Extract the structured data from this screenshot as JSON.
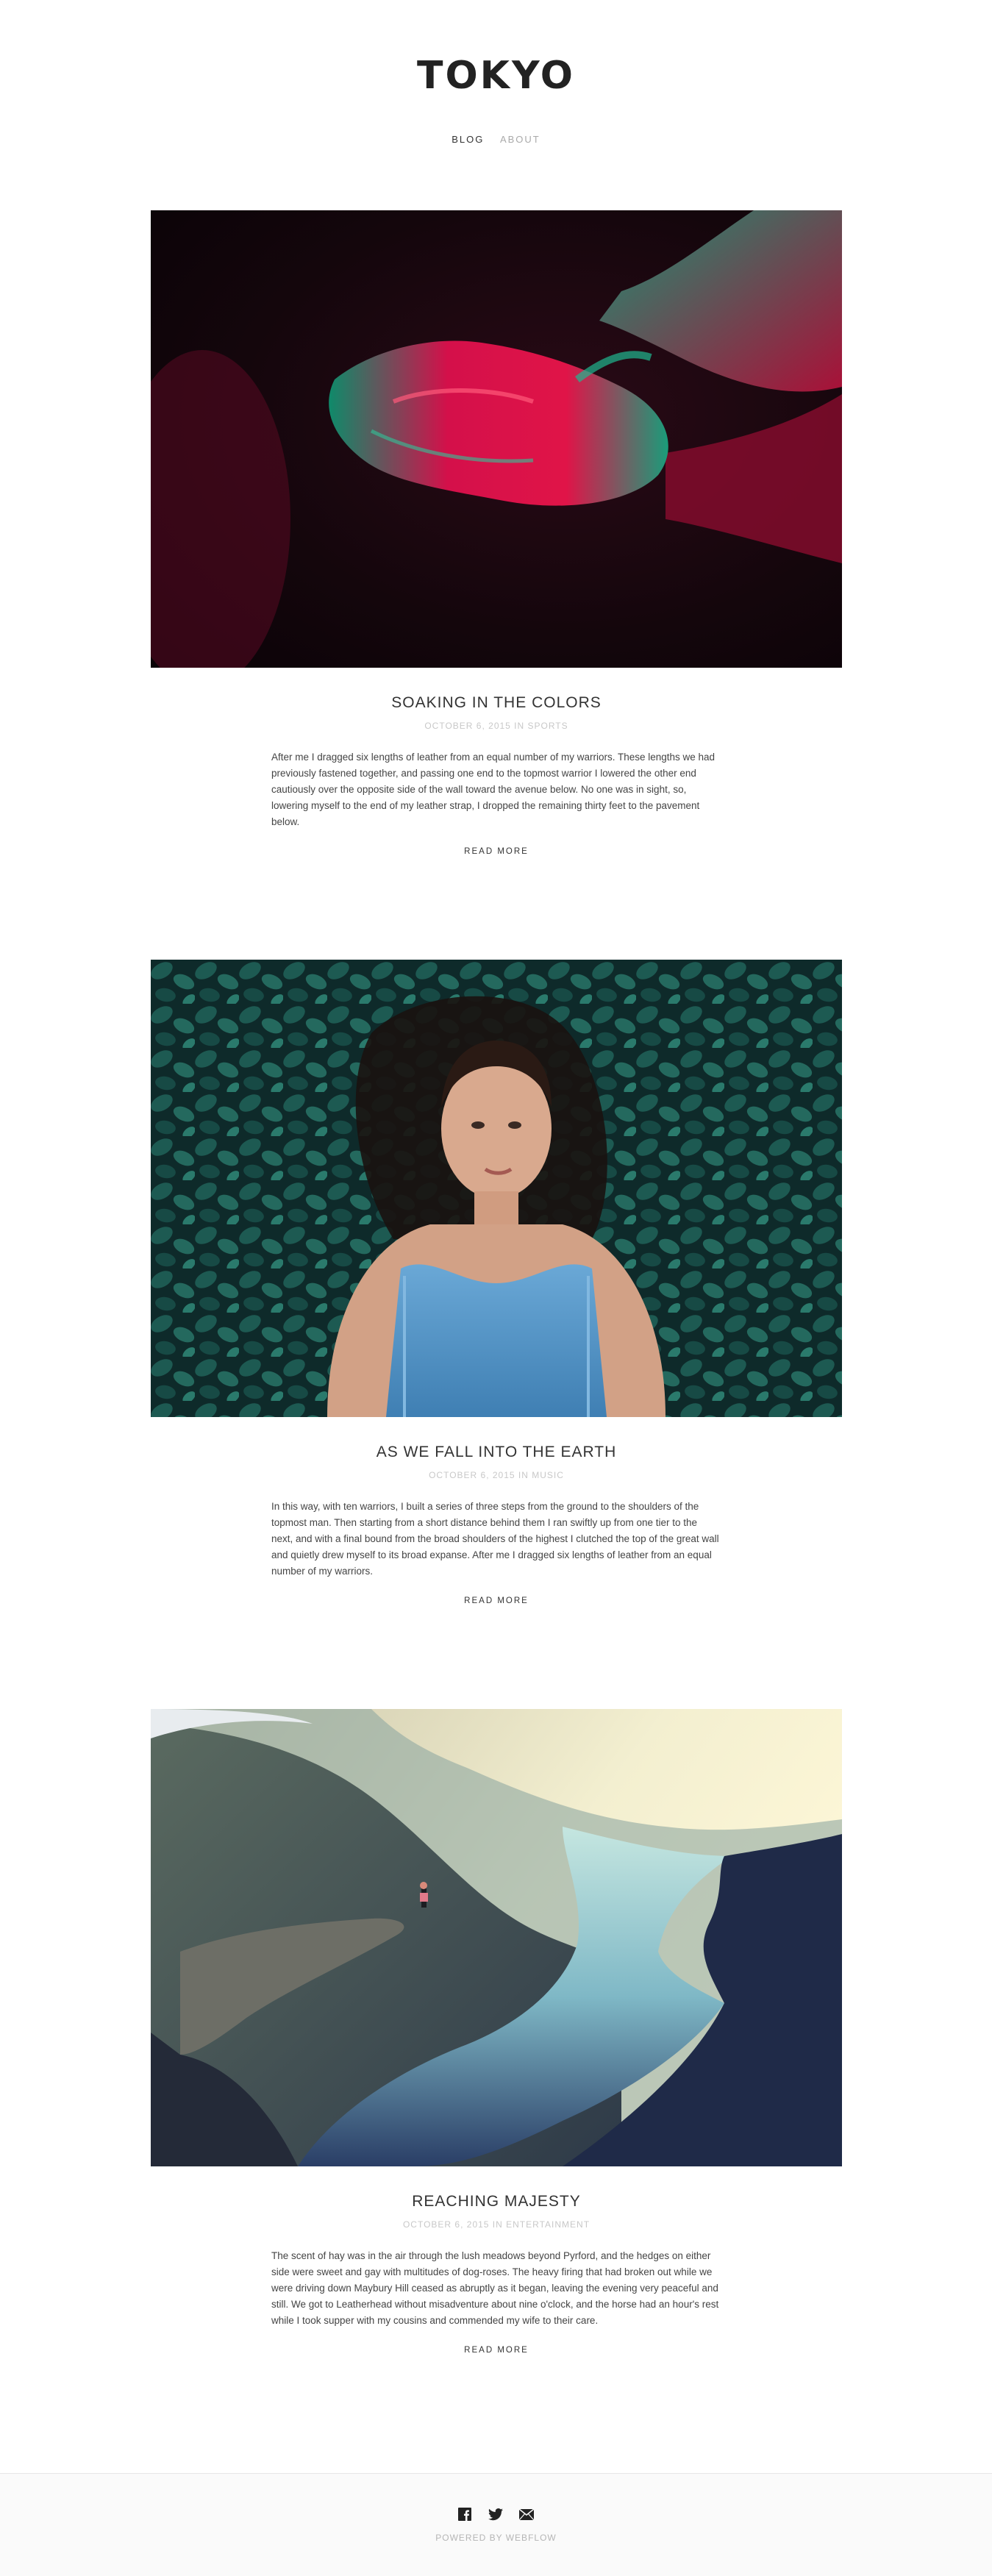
{
  "site": {
    "title": "TOKYO"
  },
  "nav": {
    "items": [
      {
        "label": "BLOG",
        "active": true
      },
      {
        "label": "ABOUT",
        "active": false
      }
    ]
  },
  "posts": [
    {
      "title": "SOAKING IN THE COLORS",
      "meta": "OCTOBER 6, 2015 IN SPORTS",
      "excerpt": "After me I dragged six lengths of leather from an equal number of my warriors. These lengths we had previously fastened together, and passing one end to the topmost warrior I lowered the other end cautiously over the opposite side of the wall toward the avenue below. No one was in sight, so, lowering myself to the end of my leather strap, I dropped the remaining thirty feet to the pavement below.",
      "read_more": "READ MORE",
      "image": "glowing-hands-photo"
    },
    {
      "title": "AS WE FALL INTO THE EARTH",
      "meta": "OCTOBER 6, 2015 IN MUSIC",
      "excerpt": "In this way, with ten warriors, I built a series of three steps from the ground to the shoulders of the topmost man. Then starting from a short distance behind them I ran swiftly up from one tier to the next, and with a final bound from the broad shoulders of the highest I clutched the top of the great wall and quietly drew myself to its broad expanse. After me I dragged six lengths of leather from an equal number of my warriors.",
      "read_more": "READ MORE",
      "image": "woman-in-leaves-photo"
    },
    {
      "title": "REACHING MAJESTY",
      "meta": "OCTOBER 6, 2015 IN ENTERTAINMENT",
      "excerpt": "The scent of hay was in the air through the lush meadows beyond Pyrford, and the hedges on either side were sweet and gay with multitudes of dog-roses. The heavy firing that had broken out while we were driving down Maybury Hill ceased as abruptly as it began, leaving the evening very peaceful and still. We got to Leatherhead without misadventure about nine o'clock, and the horse had an hour's rest while I took supper with my cousins and commended my wife to their care.",
      "read_more": "READ MORE",
      "image": "fjord-cliff-photo"
    }
  ],
  "footer": {
    "social_icons": [
      "facebook-icon",
      "twitter-icon",
      "email-icon"
    ],
    "powered_by": "POWERED BY WEBFLOW"
  }
}
